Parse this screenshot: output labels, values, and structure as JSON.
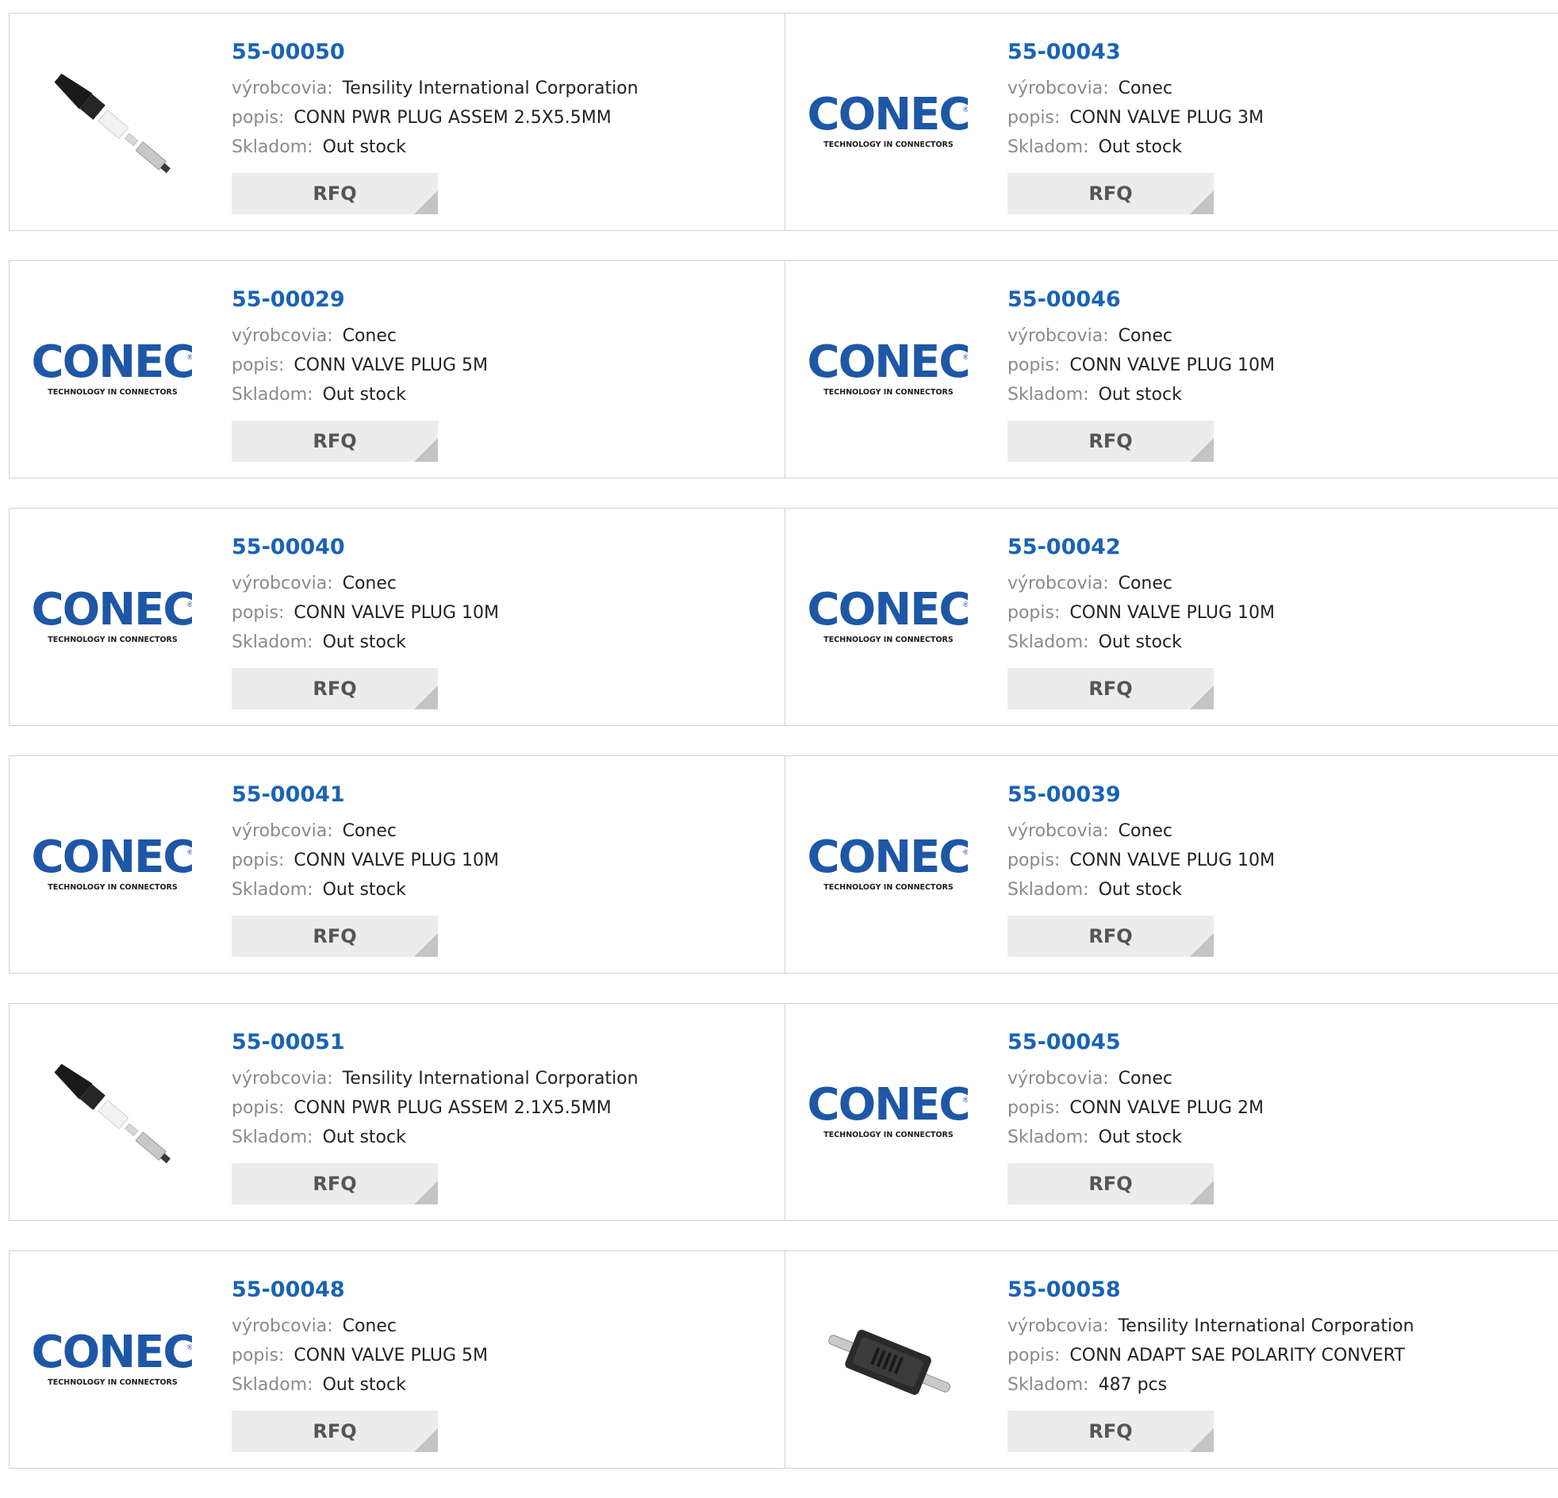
{
  "rows": [
    [
      {
        "part": "55-00050",
        "image": "tensility-plug-image",
        "manufacturer_label": "výrobcovia:",
        "manufacturer": "Tensility International Corporation",
        "description_label": "popis:",
        "description": "CONN PWR PLUG ASSEM 2.5X5.5MM",
        "stock_label": "Skladom:",
        "stock": "Out stock",
        "rfq_label": "RFQ"
      },
      {
        "part": "55-00043",
        "image": "conec-logo",
        "manufacturer_label": "výrobcovia:",
        "manufacturer": "Conec",
        "description_label": "popis:",
        "description": "CONN VALVE PLUG 3M",
        "stock_label": "Skladom:",
        "stock": "Out stock",
        "rfq_label": "RFQ"
      }
    ],
    [
      {
        "part": "55-00029",
        "image": "conec-logo",
        "manufacturer_label": "výrobcovia:",
        "manufacturer": "Conec",
        "description_label": "popis:",
        "description": "CONN VALVE PLUG 5M",
        "stock_label": "Skladom:",
        "stock": "Out stock",
        "rfq_label": "RFQ"
      },
      {
        "part": "55-00046",
        "image": "conec-logo",
        "manufacturer_label": "výrobcovia:",
        "manufacturer": "Conec",
        "description_label": "popis:",
        "description": "CONN VALVE PLUG 10M",
        "stock_label": "Skladom:",
        "stock": "Out stock",
        "rfq_label": "RFQ"
      }
    ],
    [
      {
        "part": "55-00040",
        "image": "conec-logo",
        "manufacturer_label": "výrobcovia:",
        "manufacturer": "Conec",
        "description_label": "popis:",
        "description": "CONN VALVE PLUG 10M",
        "stock_label": "Skladom:",
        "stock": "Out stock",
        "rfq_label": "RFQ"
      },
      {
        "part": "55-00042",
        "image": "conec-logo",
        "manufacturer_label": "výrobcovia:",
        "manufacturer": "Conec",
        "description_label": "popis:",
        "description": "CONN VALVE PLUG 10M",
        "stock_label": "Skladom:",
        "stock": "Out stock",
        "rfq_label": "RFQ"
      }
    ],
    [
      {
        "part": "55-00041",
        "image": "conec-logo",
        "manufacturer_label": "výrobcovia:",
        "manufacturer": "Conec",
        "description_label": "popis:",
        "description": "CONN VALVE PLUG 10M",
        "stock_label": "Skladom:",
        "stock": "Out stock",
        "rfq_label": "RFQ"
      },
      {
        "part": "55-00039",
        "image": "conec-logo",
        "manufacturer_label": "výrobcovia:",
        "manufacturer": "Conec",
        "description_label": "popis:",
        "description": "CONN VALVE PLUG 10M",
        "stock_label": "Skladom:",
        "stock": "Out stock",
        "rfq_label": "RFQ"
      }
    ],
    [
      {
        "part": "55-00051",
        "image": "tensility-plug-image",
        "manufacturer_label": "výrobcovia:",
        "manufacturer": "Tensility International Corporation",
        "description_label": "popis:",
        "description": "CONN PWR PLUG ASSEM 2.1X5.5MM",
        "stock_label": "Skladom:",
        "stock": "Out stock",
        "rfq_label": "RFQ"
      },
      {
        "part": "55-00045",
        "image": "conec-logo",
        "manufacturer_label": "výrobcovia:",
        "manufacturer": "Conec",
        "description_label": "popis:",
        "description": "CONN VALVE PLUG 2M",
        "stock_label": "Skladom:",
        "stock": "Out stock",
        "rfq_label": "RFQ"
      }
    ],
    [
      {
        "part": "55-00048",
        "image": "conec-logo",
        "manufacturer_label": "výrobcovia:",
        "manufacturer": "Conec",
        "description_label": "popis:",
        "description": "CONN VALVE PLUG 5M",
        "stock_label": "Skladom:",
        "stock": "Out stock",
        "rfq_label": "RFQ"
      },
      {
        "part": "55-00058",
        "image": "sae-adapter-image",
        "manufacturer_label": "výrobcovia:",
        "manufacturer": "Tensility International Corporation",
        "description_label": "popis:",
        "description": "CONN ADAPT SAE POLARITY CONVERT",
        "stock_label": "Skladom:",
        "stock": "487 pcs",
        "rfq_label": "RFQ"
      }
    ]
  ],
  "logo": {
    "conec_text": "CONEC",
    "conec_tagline": "TECHNOLOGY IN CONNECTORS",
    "conec_color": "#1d57a6"
  },
  "colors": {
    "link": "#1a63b5",
    "label": "#8a8a8a",
    "value": "#222222",
    "rfq_bg": "#ececec",
    "border": "#d2d2d2"
  }
}
